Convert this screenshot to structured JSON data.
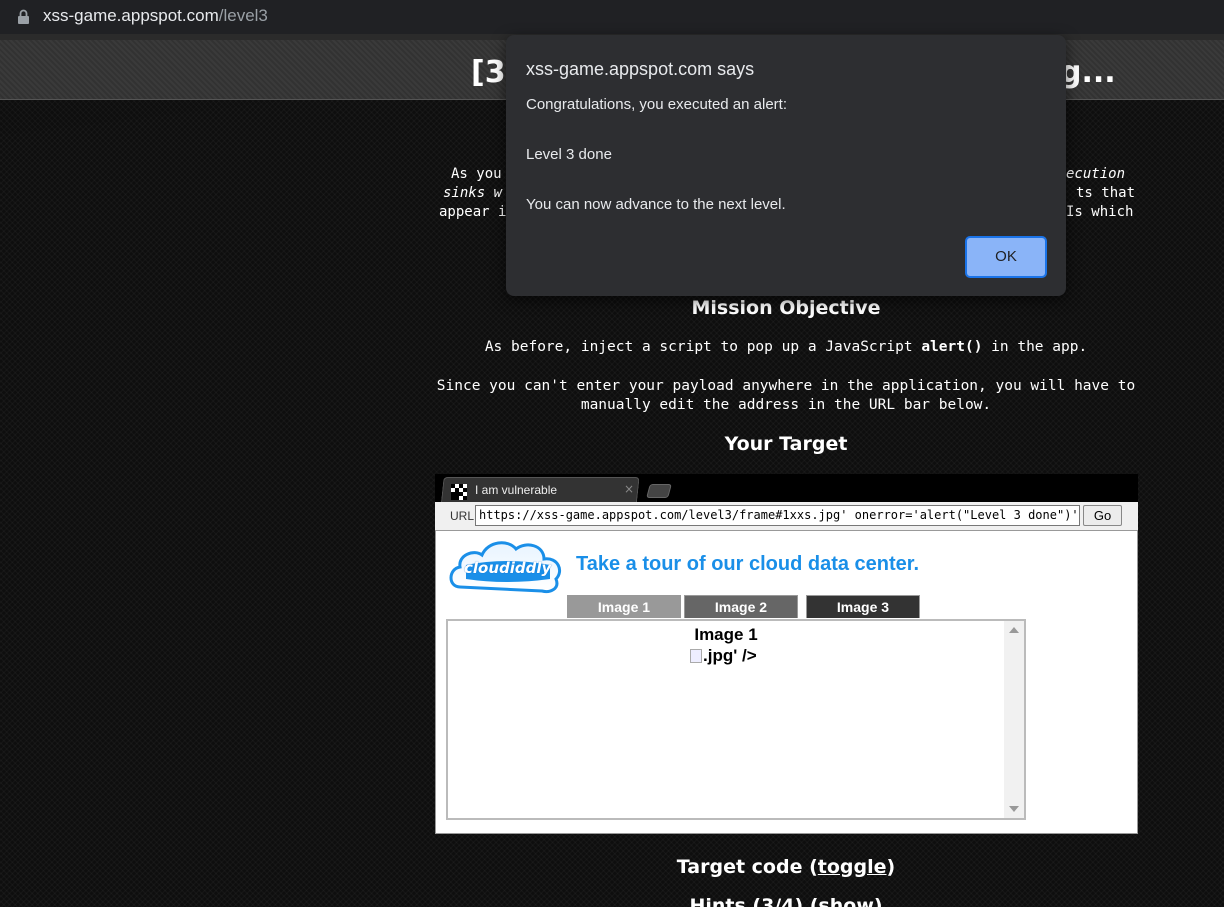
{
  "browser": {
    "url_host": "xss-game.appspot.com",
    "url_path": "/level3"
  },
  "banner": {
    "left_fragment": "[3",
    "right_fragment": "g..."
  },
  "intro": {
    "line1_left": "As you",
    "line1_right": "ecution",
    "line2_left": "sinks w",
    "line2_right": "ts that",
    "line3_left": "appear i",
    "line3_right": "Is which"
  },
  "mission": {
    "title": "Mission Objective",
    "para1_pre": "As before, inject a script to pop up a JavaScript ",
    "para1_code": "alert()",
    "para1_post": " in the app.",
    "para2": "Since you can't enter your payload anywhere in the application, you will have to manually edit the address in the URL bar below."
  },
  "target": {
    "title": "Your Target"
  },
  "frame": {
    "tab_title": "I am vulnerable",
    "tab_close": "×",
    "url_label": "URL",
    "url_value": "https://xss-game.appspot.com/level3/frame#1xxs.jpg' onerror='alert(\"Level 3 done\")'",
    "go_label": "Go",
    "logo_text": "cloudiddly",
    "tagline": "Take a tour of our cloud data center.",
    "image_tabs": [
      "Image 1",
      "Image 2",
      "Image 3"
    ],
    "viewer_title": "Image 1",
    "viewer_img_text": ".jpg' />"
  },
  "footer": {
    "target_code_pre": "Target code (",
    "target_code_link": "toggle",
    "target_code_post": ")",
    "hints_text": "Hints (3/4) (show)"
  },
  "dialog": {
    "title": "xss-game.appspot.com says",
    "line1": "Congratulations, you executed an alert:",
    "line2": "Level 3 done",
    "line3": "You can now advance to the next level.",
    "ok_label": "OK"
  },
  "colors": {
    "dialog_bg": "#2d2e31",
    "ok_button": "#8ab4f8",
    "tagline_blue": "#1a8fe8"
  }
}
